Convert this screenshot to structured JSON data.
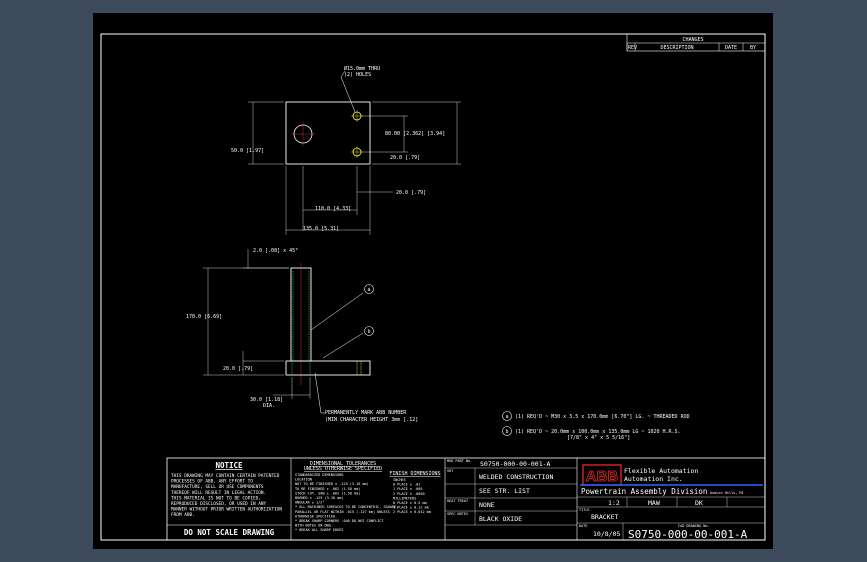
{
  "changes": {
    "title": "CHANGES",
    "rev": "REV",
    "description": "DESCRIPTION",
    "date": "DATE",
    "by": "BY"
  },
  "top_view": {
    "hole_note_1": "Ø15.0mm THRU",
    "hole_note_2": "(2) HOLES",
    "dim_height_right": "80.00 [2.362]  [3.94]",
    "dim_left": "50.0 [1.97]",
    "dim_hole_spacing": "20.0 [.79]",
    "dim_edge": "20.0 [.79]",
    "dim_width_inner": "110.0 [4.33]",
    "dim_width_total": "135.0 [5.31]"
  },
  "side_view": {
    "chamfer": "2.0 [.08] x 45°",
    "dim_height": "170.0 [6.69]",
    "dim_base": "20.0 [.79]",
    "dim_dia": "30.0 [1.18]",
    "dia_label": "DIA.",
    "callout_a": "a",
    "callout_b": "b",
    "mark_note_1": "PERMANENTLY MARK ABB NUMBER",
    "mark_note_2": "(MIN CHARACTER HEIGHT 3mm [.12]"
  },
  "bom": [
    {
      "tag": "a",
      "text": "(1) REQ'D ~ M30 x 3.5 x 170.0mm [6.70\"] LG. ~ THREADED ROD",
      "sub": ""
    },
    {
      "tag": "b",
      "text": "(1) REQ'D ~ 20.0mm x 100.0mm x 135.0mm LG ~ 1020 H.R.S.",
      "sub": "[7/8\" x 4\" x 5 5/16\"]"
    }
  ],
  "notice": {
    "title": "NOTICE",
    "lines": [
      "THIS DRAWING MAY CONTAIN CERTAIN PATENTED",
      "PROCESSES OF ABB. ANY EFFORT TO",
      "MANUFACTURE, SELL OR USE COMPONENTS",
      "THEREOF WILL RESULT IN LEGAL ACTION.",
      "THIS MATERIAL IS NOT TO BE COPIED,",
      "REPRODUCED DISCLOSED, OR USED IN ANY",
      "MANNER WITHOUT PRIOR WRITTEN AUTHORIZATION",
      "FROM ABB."
    ],
    "footer": "DO NOT SCALE DRAWING"
  },
  "tolerances": {
    "title_1": "DIMENSIONAL TOLERANCES",
    "title_2": "UNLESS OTHERWISE SPECIFIED",
    "lines": [
      "STANDARDIZED DIMENSIONS",
      "LOCATION",
      "NOT TO BE FINISHED  ± .125 (3.18 mm)",
      "TO BE FINISHED  ± .062 (1.58 mm)",
      "STOCK CUT, SAW  ± .062 (1.58 mm)",
      "BURNED  ± .125 (3.18 mm)",
      "ANGULAR ± 1/2°",
      "* ALL MACHINED SURFACES TO BE CONCENTRIC, SQUARE,",
      "PARALLEL OR FLAT WITHIN .015 (.127 mm) UNLESS",
      "OTHERWISE SPECIFIED.",
      "* BREAK SHARP CORNERS .040 DO NOT CONFLICT",
      "WITH NOTES ON DWG.",
      "* BREAK ALL SHARP EDGES"
    ],
    "finish_title": "FINISH DIMENSIONS",
    "finish_lines": [
      "INCHES",
      "0 PLACE  ± .01",
      "1 PLACE  ± .005",
      "2 PLACE  ± .0050",
      "MILLIMETERS",
      "0 PLACE  ± 0.5 mm",
      "1 PLACE  ± 0.12 mm",
      "2 PLACE  ± 0.012 mm"
    ]
  },
  "title_block": {
    "mod_part_label": "MOD PART No.",
    "mod_part": "S0750-000-00-001-A",
    "sht_label": "SHT",
    "welded": "WELDED CONSTRUCTION",
    "see_list": "SEE STR. LIST",
    "heat_treat_label": "HEAT TREAT",
    "heat_treat": "NONE",
    "spec_label": "SPEC NOTES",
    "spec": "BLACK OXIDE",
    "logo": "ABB",
    "company_1": "Flexible Automation",
    "company_2": "Automation Inc.",
    "division": "Powertrain Assembly Division",
    "location": "Auburn Hills, MI",
    "scale": "1:2",
    "drawn": "MAW",
    "checked": "DK",
    "title_label": "TITLE",
    "title": "BRACKET",
    "date_label": "DATE",
    "date": "10/8/05",
    "dwg_label": "CAD DRAWING No.",
    "dwg": "S0750-000-00-001-A"
  }
}
